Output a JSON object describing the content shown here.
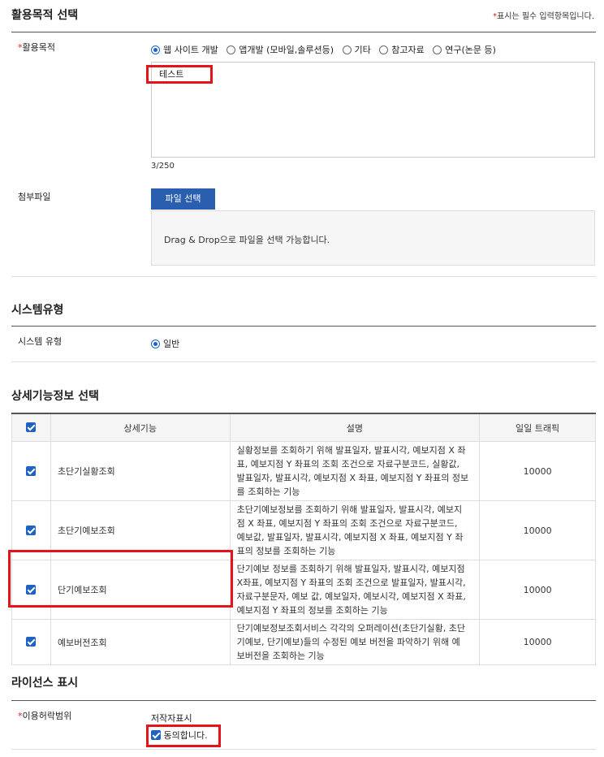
{
  "purpose_section": {
    "title": "활용목적 선택",
    "required_note_mark": "*",
    "required_note": "표시는 필수 입력항목입니다.",
    "field_label": "활용목적",
    "required_mark": "*",
    "options": [
      {
        "label": "웹 사이트 개발",
        "selected": true
      },
      {
        "label": "앱개발 (모바일,솔루션등)",
        "selected": false
      },
      {
        "label": "기타",
        "selected": false
      },
      {
        "label": "참고자료",
        "selected": false
      },
      {
        "label": "연구(논문 등)",
        "selected": false
      }
    ],
    "textarea_value": "테스트",
    "char_count": "3/250"
  },
  "attachment": {
    "label": "첨부파일",
    "button": "파일 선택",
    "dropzone_text": "Drag & Drop으로 파일을 선택 가능합니다."
  },
  "system_section": {
    "title": "시스템유형",
    "field_label": "시스템 유형",
    "option": {
      "label": "일반",
      "selected": true
    }
  },
  "features_section": {
    "title": "상세기능정보 선택",
    "headers": [
      "상세기능",
      "설명",
      "일일 트래픽"
    ],
    "rows": [
      {
        "name": "초단기실황조회",
        "desc_lines": [
          "실황정보를 조회하기 위해 발표일자, 발표시각, 예보지점 X 좌",
          "표, 예보지점 Y 좌표의 조회 조건으로 자료구분코드, 실황값,",
          "발표일자, 발표시각, 예보지점 X 좌표, 예보지점 Y 좌표의 정보",
          "를 조회하는 기능"
        ],
        "traffic": "10000",
        "checked": true
      },
      {
        "name": "초단기예보조회",
        "desc_lines": [
          "초단기예보정보를 조회하기 위해 발표일자, 발표시각, 예보지",
          "점 X 좌표, 예보지점 Y 좌표의 조회 조건으로 자료구분코드,",
          "예보값, 발표일자, 발표시각, 예보지점 X 좌표, 예보지점 Y 좌",
          "표의 정보를 조회하는 기능"
        ],
        "traffic": "10000",
        "checked": true
      },
      {
        "name": "단기예보조회",
        "desc_lines": [
          "단기예보 정보를 조회하기 위해 발표일자, 발표시각, 예보지점",
          "X좌표, 예보지점 Y 좌표의 조회 조건으로 발표일자, 발표시각,",
          "자료구분문자, 예보 값, 예보일자, 예보시각, 예보지점 X 좌표,",
          "예보지점 Y 좌표의 정보를 조회하는 기능"
        ],
        "traffic": "10000",
        "checked": true
      },
      {
        "name": "예보버전조회",
        "desc_lines": [
          "단기예보정보조회서비스 각각의 오퍼레이션(초단기실황, 초단",
          "기예보, 단기예보)들의 수정된 예보 버전을 파악하기 위해 예",
          "보버전을 조회하는 기능"
        ],
        "traffic": "10000",
        "checked": true
      }
    ]
  },
  "license_section": {
    "title": "라이선스 표시",
    "field_label": "이용허락범위",
    "required_mark": "*",
    "license_type": "저작자표시",
    "agree_label": "동의합니다.",
    "agreed": true
  }
}
